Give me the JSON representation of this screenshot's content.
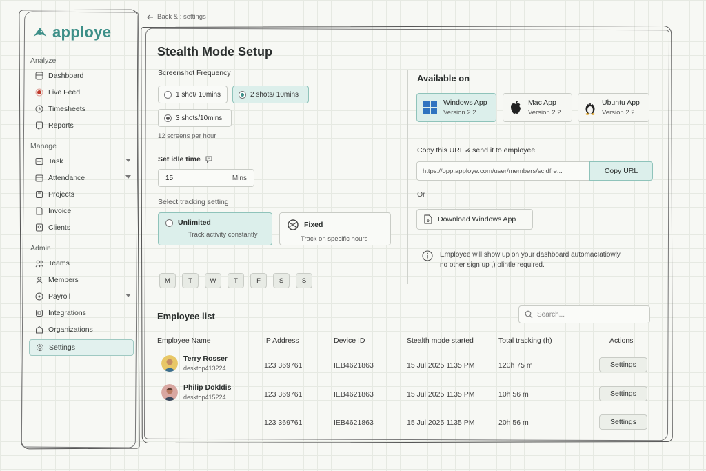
{
  "brand": {
    "name": "apploye",
    "color": "#3d8f88"
  },
  "breadcrumb": {
    "text": "Back & : settings"
  },
  "sidebar": {
    "sections": [
      {
        "title": "Analyze",
        "items": [
          {
            "label": "Dashboard",
            "icon": "dashboard-icon"
          },
          {
            "label": "Live Feed",
            "icon": "live-feed-icon"
          },
          {
            "label": "Timesheets",
            "icon": "clock-icon"
          },
          {
            "label": "Reports",
            "icon": "reports-icon"
          }
        ]
      },
      {
        "title": "Manage",
        "items": [
          {
            "label": "Task",
            "icon": "task-icon"
          },
          {
            "label": "Attendance",
            "icon": "attendance-icon"
          },
          {
            "label": "Projects",
            "icon": "projects-icon"
          },
          {
            "label": "Invoice",
            "icon": "invoice-icon"
          },
          {
            "label": "Clients",
            "icon": "clients-icon"
          }
        ]
      },
      {
        "title": "Admin",
        "items": [
          {
            "label": "Teams",
            "icon": "teams-icon"
          },
          {
            "label": "Members",
            "icon": "members-icon"
          },
          {
            "label": "Payroll",
            "icon": "payroll-icon"
          },
          {
            "label": "Integrations",
            "icon": "integrations-icon"
          },
          {
            "label": "Organizations",
            "icon": "organizations-icon"
          },
          {
            "label": "Settings",
            "icon": "settings-icon",
            "active": true
          }
        ]
      }
    ]
  },
  "setup": {
    "title": "Stealth Mode Setup",
    "frequency": {
      "label": "Screenshot Frequency",
      "options": [
        "1 shot/ 10mins",
        "2 shots/ 10mins",
        "3 shots/10mins"
      ],
      "selected": "2 shots/ 10mins",
      "note": "12 screens per hour"
    },
    "idle": {
      "label": "Set idle time",
      "value": "15",
      "unit": "Mins"
    },
    "tracking": {
      "label": "Select tracking setting",
      "options": [
        {
          "title": "Unlimited",
          "desc": "Track activity constantly"
        },
        {
          "title": "Fixed",
          "desc": "Track on specific hours"
        }
      ],
      "selected": "Unlimited"
    },
    "days": [
      "M",
      "T",
      "W",
      "T",
      "F",
      "S",
      "S"
    ]
  },
  "available": {
    "heading": "Available on",
    "apps": [
      {
        "name": "Windows App",
        "version": "Version 2.2"
      },
      {
        "name": "Mac App",
        "version": "Version 2.2"
      },
      {
        "name": "Ubuntu App",
        "version": "Version 2.2"
      }
    ],
    "url_label": "Copy this URL & send it to employee",
    "url_value": "https://opp.apploye.com/user/members/scldfre...",
    "copy_button": "Copy URL",
    "or_text": "Or",
    "download_button": "Download Windows App",
    "info_line1": "Employee will show up on your dashboard automacIatiowly",
    "info_line2": "no other sign up ,) olintle required."
  },
  "employees": {
    "heading": "Employee list",
    "search_placeholder": "Search...",
    "columns": [
      "Employee Name",
      "IP Address",
      "Device ID",
      "Stealth mode started",
      "Total tracking (h)",
      "Actions"
    ],
    "rows": [
      {
        "name": "Terry Rosser",
        "device": "desktop413224",
        "ip": "123 369761",
        "device_id": "IEB4621863",
        "started": "15 Jul 2025 1135 PM",
        "total": "120h 75 m",
        "action": "Settings"
      },
      {
        "name": "Philip Dokldis",
        "device": "desktop415224",
        "ip": "123 369761",
        "device_id": "IEB4621863",
        "started": "15 Jul 2025 1135 PM",
        "total": "10h 56 m",
        "action": "Settings"
      },
      {
        "name": "",
        "device": "",
        "ip": "123 369761",
        "device_id": "IEB4621863",
        "started": "15 Jul 2025 1135 PM",
        "total": "20h 56 m",
        "action": "Settings"
      }
    ]
  }
}
